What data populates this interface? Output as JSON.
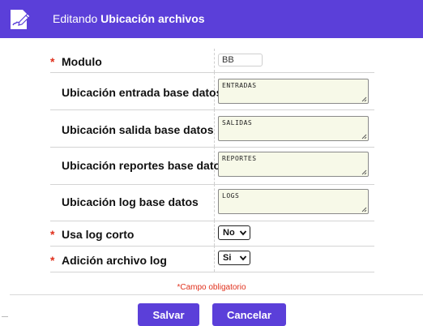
{
  "header": {
    "prefix": "Editando",
    "entity": "Ubicación archivos",
    "icon": "edit-document-icon"
  },
  "fields": {
    "modulo": {
      "label": "Modulo",
      "required": true,
      "value": "BB"
    },
    "entrada": {
      "label": "Ubicación entrada base datos",
      "required": false,
      "value": "ENTRADAS"
    },
    "salida": {
      "label": "Ubicación salida base datos",
      "required": false,
      "value": "SALIDAS"
    },
    "reportes": {
      "label": "Ubicación reportes base datos",
      "required": false,
      "value": "REPORTES"
    },
    "log": {
      "label": "Ubicación log base datos",
      "required": false,
      "value": "LOGS"
    },
    "log_corto": {
      "label": "Usa log corto",
      "required": true,
      "value": "No"
    },
    "adicion_log": {
      "label": "Adición archivo log",
      "required": true,
      "value": "Si"
    }
  },
  "required_mark": "*",
  "required_note": "*Campo obligatorio",
  "buttons": {
    "save": "Salvar",
    "cancel": "Cancelar"
  },
  "colors": {
    "accent": "#5b3fd9",
    "required": "#e0311d",
    "textarea_bg": "#f7f9e8"
  }
}
